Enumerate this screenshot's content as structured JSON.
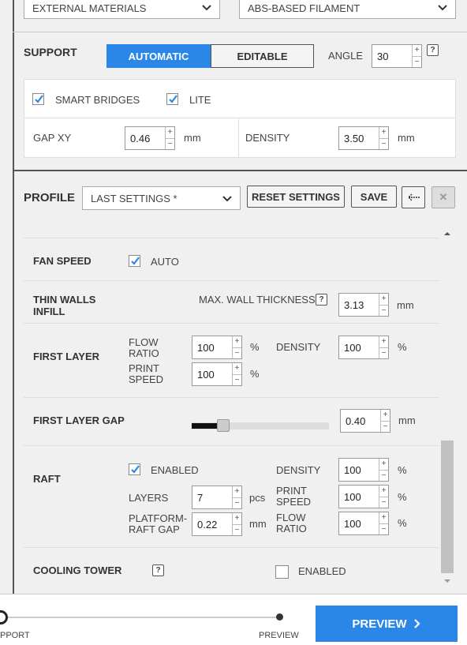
{
  "materials": {
    "source_select": "EXTERNAL MATERIALS",
    "filament_select": "ABS-BASED FILAMENT"
  },
  "support": {
    "title": "SUPPORT",
    "mode_automatic": "AUTOMATIC",
    "mode_editable": "EDITABLE",
    "angle_label": "ANGLE",
    "angle_value": "30",
    "smart_bridges_label": "SMART BRIDGES",
    "smart_bridges_checked": true,
    "lite_label": "LITE",
    "lite_checked": true,
    "gap_xy_label": "GAP XY",
    "gap_xy_value": "0.46",
    "gap_xy_unit": "mm",
    "density_label": "DENSITY",
    "density_value": "3.50",
    "density_unit": "mm"
  },
  "profile": {
    "title": "PROFILE",
    "selected": "LAST SETTINGS *",
    "reset_label": "RESET SETTINGS",
    "save_label": "SAVE"
  },
  "settings": {
    "fan_speed": {
      "title": "FAN SPEED",
      "auto_label": "AUTO",
      "auto_checked": true
    },
    "thin_walls": {
      "title_line1": "THIN WALLS",
      "title_line2": "INFILL",
      "max_wall_label": "MAX. WALL THICKNESS",
      "max_wall_value": "3.13",
      "unit": "mm"
    },
    "first_layer": {
      "title": "FIRST LAYER",
      "flow_label_1": "FLOW",
      "flow_label_2": "RATIO",
      "flow_value": "100",
      "flow_unit": "%",
      "speed_label_1": "PRINT",
      "speed_label_2": "SPEED",
      "speed_value": "100",
      "speed_unit": "%",
      "density_label": "DENSITY",
      "density_value": "100",
      "density_unit": "%"
    },
    "first_layer_gap": {
      "title": "FIRST LAYER GAP",
      "value": "0.40",
      "unit": "mm",
      "slider_fraction": 0.23
    },
    "raft": {
      "title": "RAFT",
      "enabled_label": "ENABLED",
      "enabled_checked": true,
      "layers_label": "LAYERS",
      "layers_value": "7",
      "layers_unit": "pcs",
      "gap_label_1": "PLATFORM-",
      "gap_label_2": "RAFT GAP",
      "gap_value": "0.22",
      "gap_unit": "mm",
      "density_label": "DENSITY",
      "density_value": "100",
      "density_unit": "%",
      "speed_label_1": "PRINT",
      "speed_label_2": "SPEED",
      "speed_value": "100",
      "speed_unit": "%",
      "flow_label_1": "FLOW",
      "flow_label_2": "RATIO",
      "flow_value": "100",
      "flow_unit": "%"
    },
    "cooling_tower": {
      "title": "COOLING TOWER",
      "enabled_label": "ENABLED",
      "enabled_checked": false
    }
  },
  "footer": {
    "step_support": "PPORT",
    "step_preview": "PREVIEW",
    "preview_button": "PREVIEW"
  },
  "colors": {
    "accent": "#2a87e8",
    "check": "#2a87e8"
  }
}
